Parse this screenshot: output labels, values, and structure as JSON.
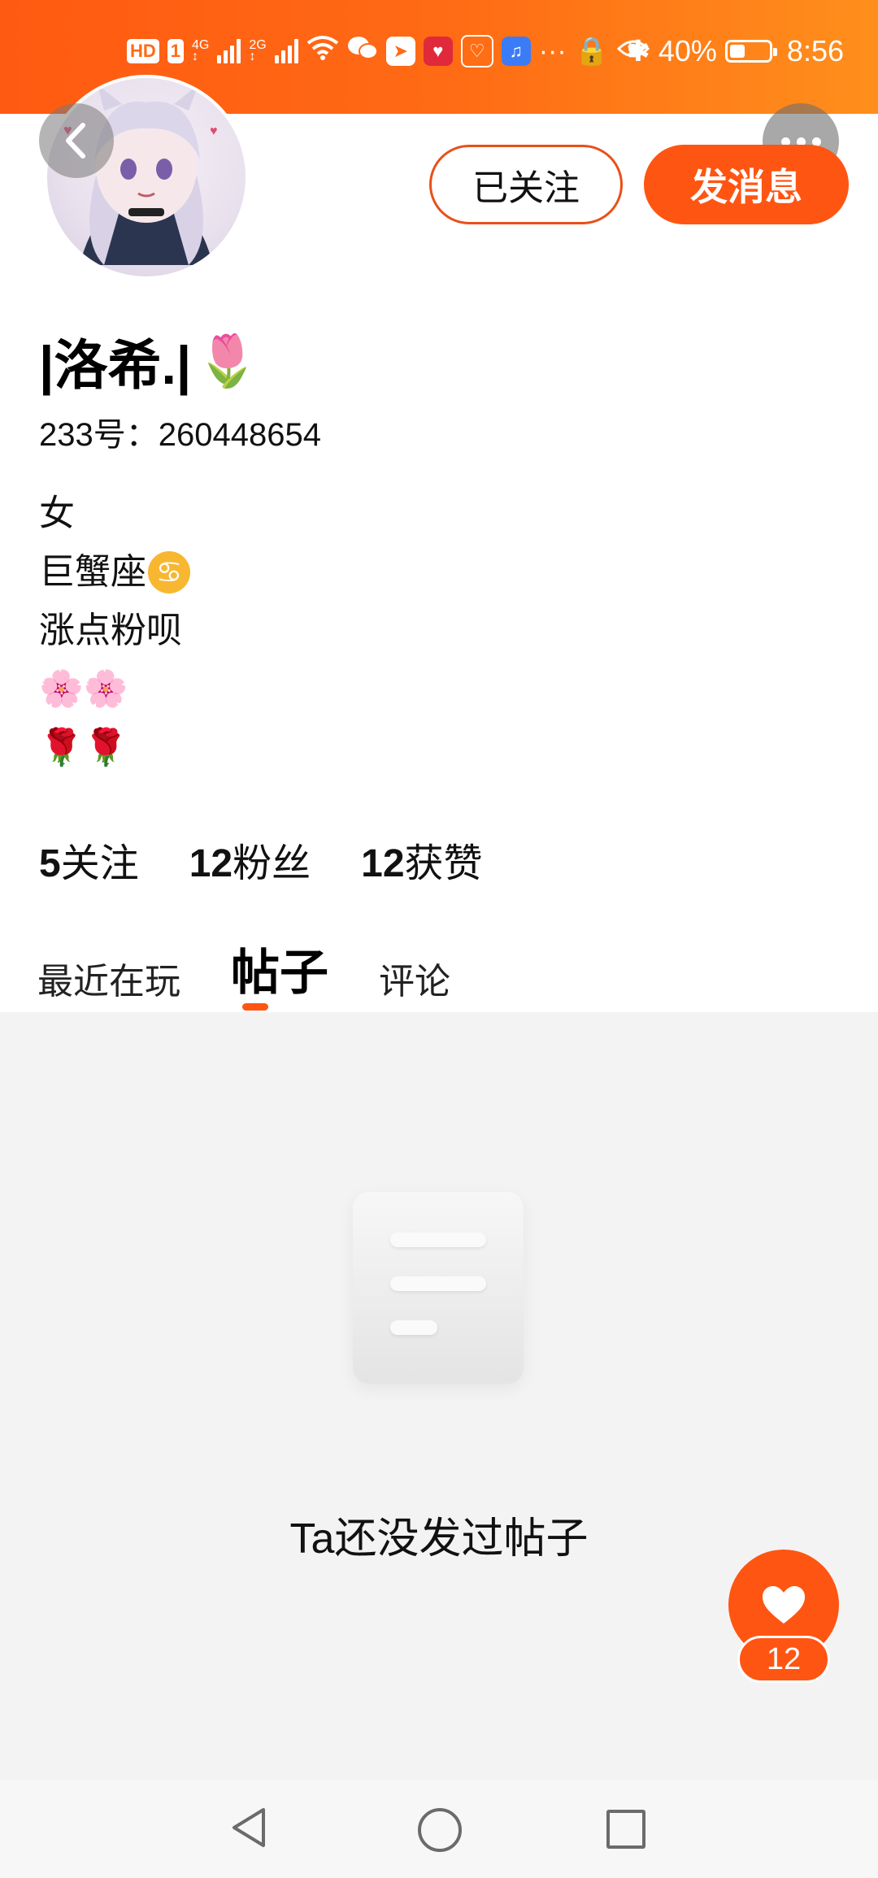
{
  "status_bar": {
    "hd_badge": "HD",
    "sim1": "1",
    "net1": "4G",
    "net2": "2G",
    "battery_percent": "40%",
    "battery_level": 0.4,
    "time": "8:56",
    "icons": [
      "hd-icon",
      "signal-icon",
      "wifi-icon",
      "wechat-icon",
      "app-icon",
      "app-icon",
      "app-icon",
      "music-icon",
      "more-notifications-icon",
      "vpn-icon",
      "eye-icon",
      "bluetooth-icon",
      "battery-icon"
    ]
  },
  "header": {
    "back_icon": "back-arrow-icon",
    "more_icon": "more-icon",
    "follow_button": "已关注",
    "message_button": "发消息"
  },
  "profile": {
    "username": "|洛希.|",
    "username_emoji": "🌷",
    "uid": "233号：260448654",
    "bio": {
      "line1": "女",
      "line2": "巨蟹座",
      "line2_emoji": "♋",
      "line3": "涨点粉呗",
      "line4": "🌸🌸",
      "line5": "🌹🌹"
    }
  },
  "stats": {
    "following_count": "5",
    "following_label": "关注",
    "followers_count": "12",
    "followers_label": "粉丝",
    "likes_count": "12",
    "likes_label": "获赞"
  },
  "tabs": {
    "recent": "最近在玩",
    "posts": "帖子",
    "comments": "评论",
    "active": "帖子"
  },
  "content": {
    "empty_message": "Ta还没发过帖子"
  },
  "like_fab": {
    "count": "12",
    "icon": "heart-icon"
  },
  "navigation": {
    "back": "back-triangle-icon",
    "home": "home-circle-icon",
    "recent": "recent-square-icon"
  },
  "colors": {
    "accent": "#ff5512",
    "status_bar_start": "#ff5a12",
    "status_bar_end": "#ff8f1c",
    "content_bg": "#f3f3f3"
  }
}
